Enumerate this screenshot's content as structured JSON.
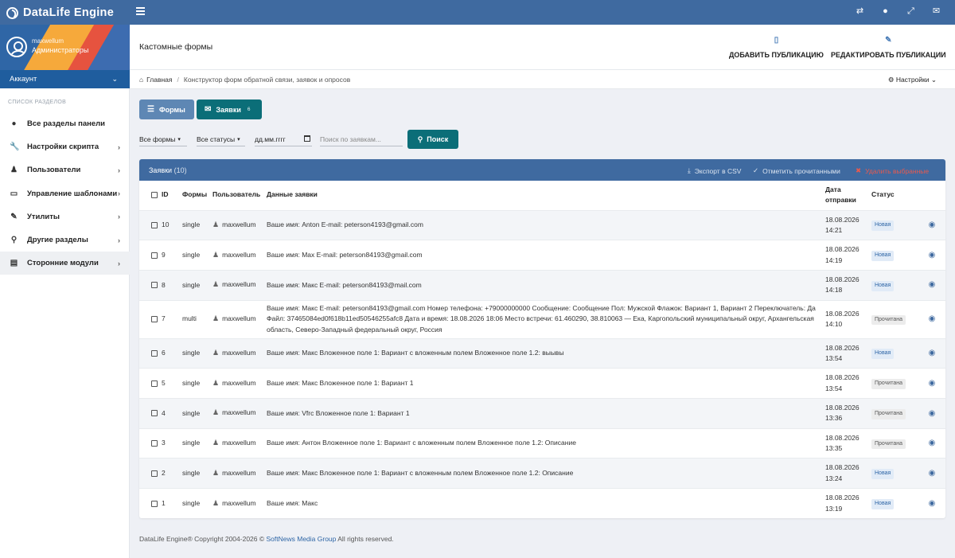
{
  "topbar": {
    "brand": "DataLife Engine"
  },
  "user": {
    "name": "maxwellum",
    "role": "Администраторы",
    "account_label": "Аккаунт"
  },
  "sidebar": {
    "section_title": "СПИСОК РАЗДЕЛОВ",
    "items": [
      {
        "label": "Все разделы панели",
        "icon": "globe-icon",
        "glyph": "●",
        "has_chevron": false
      },
      {
        "label": "Настройки скрипта",
        "icon": "wrench-icon",
        "glyph": "🔧",
        "has_chevron": true
      },
      {
        "label": "Пользователи",
        "icon": "user-icon",
        "glyph": "♟",
        "has_chevron": true
      },
      {
        "label": "Управление шаблонами",
        "icon": "laptop-icon",
        "glyph": "▭",
        "has_chevron": true
      },
      {
        "label": "Утилиты",
        "icon": "leaf-icon",
        "glyph": "✎",
        "has_chevron": true
      },
      {
        "label": "Другие разделы",
        "icon": "share-icon",
        "glyph": "⚲",
        "has_chevron": true
      },
      {
        "label": "Сторонние модули",
        "icon": "list-icon",
        "glyph": "▤",
        "has_chevron": true,
        "active": true
      }
    ]
  },
  "header": {
    "title": "Кастомные формы",
    "add_label": "Добавить публикацию",
    "edit_label": "Редактировать публикации"
  },
  "breadcrumb": {
    "home": "Главная",
    "current": "Конструктор форм обратной связи, заявок и опросов",
    "settings": "Настройки"
  },
  "tabs": {
    "forms": "Формы",
    "requests": "Заявки",
    "requests_badge": "6"
  },
  "filters": {
    "forms": "Все формы",
    "statuses": "Все статусы",
    "date_placeholder": "дд.мм.гггг",
    "search_placeholder": "Поиск по заявкам...",
    "search_button": "Поиск"
  },
  "panel": {
    "title": "Заявки",
    "count": "(10)",
    "export": "Экспорт в CSV",
    "mark_read": "Отметить прочитанными",
    "delete": "Удалить выбранные"
  },
  "table": {
    "columns": {
      "id": "ID",
      "form": "Формы",
      "user": "Пользователь",
      "data": "Данные заявки",
      "date": "Дата отправки",
      "status": "Статус"
    },
    "rows": [
      {
        "id": "10",
        "form": "single",
        "user": "maxwellum",
        "data": "Ваше имя: Anton E-mail: peterson4193@gmail.com",
        "date": "18.08.2026",
        "time": "14:21",
        "status": "Новая",
        "status_type": "new"
      },
      {
        "id": "9",
        "form": "single",
        "user": "maxwellum",
        "data": "Ваше имя: Max E-mail: peterson84193@gmail.com",
        "date": "18.08.2026",
        "time": "14:19",
        "status": "Новая",
        "status_type": "new"
      },
      {
        "id": "8",
        "form": "single",
        "user": "maxwellum",
        "data": "Ваше имя: Макс E-mail: peterson84193@mail.com",
        "date": "18.08.2026",
        "time": "14:18",
        "status": "Новая",
        "status_type": "new"
      },
      {
        "id": "7",
        "form": "multi",
        "user": "maxwellum",
        "data": "Ваше имя: Макс E-mail: peterson84193@gmail.com Номер телефона: +79000000000 Сообщение: Сообщение Пол: Мужской Флажок: Вариант 1, Вариант 2 Переключатель: Да Файл: 37465084ed0f618b11ed50546255afc8 Дата и время: 18.08.2026 18:06 Место встречи: 61.460290, 38.810063 — Ека, Каргопольский муниципальный округ, Архангельская область, Северо-Западный федеральный округ, Россия",
        "date": "18.08.2026",
        "time": "14:10",
        "status": "Прочитана",
        "status_type": "read",
        "tall": true
      },
      {
        "id": "6",
        "form": "single",
        "user": "maxwellum",
        "data": "Ваше имя: Макс Вложенное поле 1: Вариант с вложенным полем Вложенное поле 1.2: выывы",
        "date": "18.08.2026",
        "time": "13:54",
        "status": "Новая",
        "status_type": "new"
      },
      {
        "id": "5",
        "form": "single",
        "user": "maxwellum",
        "data": "Ваше имя: Макс Вложенное поле 1: Вариант 1",
        "date": "18.08.2026",
        "time": "13:54",
        "status": "Прочитана",
        "status_type": "read"
      },
      {
        "id": "4",
        "form": "single",
        "user": "maxwellum",
        "data": "Ваше имя: Vfrc Вложенное поле 1: Вариант 1",
        "date": "18.08.2026",
        "time": "13:36",
        "status": "Прочитана",
        "status_type": "read"
      },
      {
        "id": "3",
        "form": "single",
        "user": "maxwellum",
        "data": "Ваше имя: Антон Вложенное поле 1: Вариант с вложенным полем Вложенное поле 1.2: Описание",
        "date": "18.08.2026",
        "time": "13:35",
        "status": "Прочитана",
        "status_type": "read"
      },
      {
        "id": "2",
        "form": "single",
        "user": "maxwellum",
        "data": "Ваше имя: Макс Вложенное поле 1: Вариант с вложенным полем Вложенное поле 1.2: Описание",
        "date": "18.08.2026",
        "time": "13:24",
        "status": "Новая",
        "status_type": "new"
      },
      {
        "id": "1",
        "form": "single",
        "user": "maxwellum",
        "data": "Ваше имя: Макс",
        "date": "18.08.2026",
        "time": "13:19",
        "status": "Новая",
        "status_type": "new"
      }
    ]
  },
  "footer": {
    "before": "DataLife Engine® Copyright 2004-2026 © ",
    "link": "SoftNews Media Group",
    "after": " All rights reserved."
  },
  "colors": {
    "header": "#3f6aa0",
    "accent": "#0b6e78",
    "link": "#2f66a6",
    "danger": "#e65a4f"
  }
}
